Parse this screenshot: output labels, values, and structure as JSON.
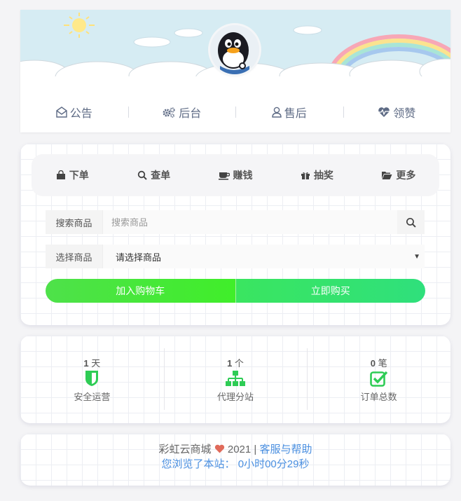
{
  "header": {
    "nav": [
      {
        "icon": "envelope-open-icon",
        "label": "公告"
      },
      {
        "icon": "gears-icon",
        "label": "后台"
      },
      {
        "icon": "user-icon",
        "label": "售后"
      },
      {
        "icon": "heartbeat-icon",
        "label": "领赞"
      }
    ]
  },
  "tabs": [
    {
      "icon": "shopping-bag-icon",
      "label": "下单"
    },
    {
      "icon": "search-icon",
      "label": "查单"
    },
    {
      "icon": "coffee-cup-icon",
      "label": "赚钱"
    },
    {
      "icon": "gift-icon",
      "label": "抽奖"
    },
    {
      "icon": "folder-open-icon",
      "label": "更多"
    }
  ],
  "form": {
    "search_label": "搜索商品",
    "search_placeholder": "搜索商品",
    "search_value": "",
    "select_label": "选择商品",
    "select_value": "请选择商品"
  },
  "buttons": {
    "cart": "加入购物车",
    "buy": "立即购买"
  },
  "stats": [
    {
      "count": "1",
      "unit": "天",
      "label": "安全运营",
      "icon": "shield-icon"
    },
    {
      "count": "1",
      "unit": "个",
      "label": "代理分站",
      "icon": "sitemap-icon"
    },
    {
      "count": "0",
      "unit": "笔",
      "label": "订单总数",
      "icon": "check-square-icon"
    }
  ],
  "footer": {
    "site_name": "彩虹云商城",
    "year": "2021",
    "separator": "|",
    "help_link": "客服与帮助",
    "browsed_label": "您浏览了本站：",
    "browsed_time": "0小时00分29秒"
  },
  "colors": {
    "accent_green": "#3de45a",
    "link_blue": "#4a8fe0",
    "heart_red": "#e06a5a",
    "nav_text": "#5e6b85"
  }
}
